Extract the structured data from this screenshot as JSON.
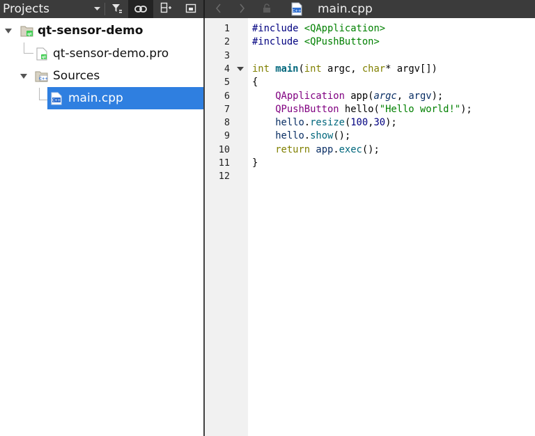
{
  "projects_panel": {
    "title": "Projects",
    "tree": [
      {
        "label": "qt-sensor-demo",
        "kind": "project",
        "expanded": true
      },
      {
        "label": "qt-sensor-demo.pro",
        "kind": "pro-file"
      },
      {
        "label": "Sources",
        "kind": "folder",
        "expanded": true
      },
      {
        "label": "main.cpp",
        "kind": "cpp-file",
        "selected": true
      }
    ]
  },
  "editor": {
    "open_file": "main.cpp",
    "file_icon_text": "C++",
    "line_numbers": [
      "1",
      "2",
      "3",
      "4",
      "5",
      "6",
      "7",
      "8",
      "9",
      "10",
      "11",
      "12"
    ],
    "lines": [
      [
        {
          "t": "#include ",
          "c": "pre"
        },
        {
          "t": "<QApplication>",
          "c": "str"
        }
      ],
      [
        {
          "t": "#include ",
          "c": "pre"
        },
        {
          "t": "<QPushButton>",
          "c": "str"
        }
      ],
      [],
      [
        {
          "t": "int",
          "c": "kw"
        },
        {
          "t": " "
        },
        {
          "t": "main",
          "c": "fnb"
        },
        {
          "t": "("
        },
        {
          "t": "int",
          "c": "kw"
        },
        {
          "t": " argc, "
        },
        {
          "t": "char",
          "c": "kw"
        },
        {
          "t": "* argv[])"
        }
      ],
      [
        {
          "t": "{"
        }
      ],
      [
        {
          "t": "    "
        },
        {
          "t": "QApplication",
          "c": "type"
        },
        {
          "t": " app("
        },
        {
          "t": "argc",
          "c": "it"
        },
        {
          "t": ", "
        },
        {
          "t": "argv",
          "c": "var"
        },
        {
          "t": ");"
        }
      ],
      [
        {
          "t": "    "
        },
        {
          "t": "QPushButton",
          "c": "type"
        },
        {
          "t": " hello("
        },
        {
          "t": "\"Hello world!\"",
          "c": "str"
        },
        {
          "t": ");"
        }
      ],
      [
        {
          "t": "    "
        },
        {
          "t": "hello",
          "c": "var"
        },
        {
          "t": "."
        },
        {
          "t": "resize",
          "c": "fn"
        },
        {
          "t": "("
        },
        {
          "t": "100",
          "c": "num"
        },
        {
          "t": ","
        },
        {
          "t": "30",
          "c": "num"
        },
        {
          "t": ");"
        }
      ],
      [
        {
          "t": "    "
        },
        {
          "t": "hello",
          "c": "var"
        },
        {
          "t": "."
        },
        {
          "t": "show",
          "c": "fn"
        },
        {
          "t": "();"
        }
      ],
      [
        {
          "t": "    "
        },
        {
          "t": "return",
          "c": "kw"
        },
        {
          "t": " "
        },
        {
          "t": "app",
          "c": "var"
        },
        {
          "t": "."
        },
        {
          "t": "exec",
          "c": "fn"
        },
        {
          "t": "();"
        }
      ],
      [
        {
          "t": "}"
        }
      ],
      []
    ],
    "foldable_line": "4"
  },
  "colors": {
    "toolbar_bg": "#3b3b3b",
    "selection": "#2f7fe0",
    "gutter_bg": "#f1f1f1",
    "keyword": "#808000",
    "string": "#008000",
    "preprocessor": "#000080",
    "type": "#800080",
    "function": "#00677c"
  },
  "icons": {
    "filter": "filter-icon",
    "link": "link-icon",
    "split": "split-view-icon",
    "close_pane": "close-pane-icon",
    "back": "chevron-left-icon",
    "forward": "chevron-right-icon",
    "lock": "lock-icon"
  }
}
